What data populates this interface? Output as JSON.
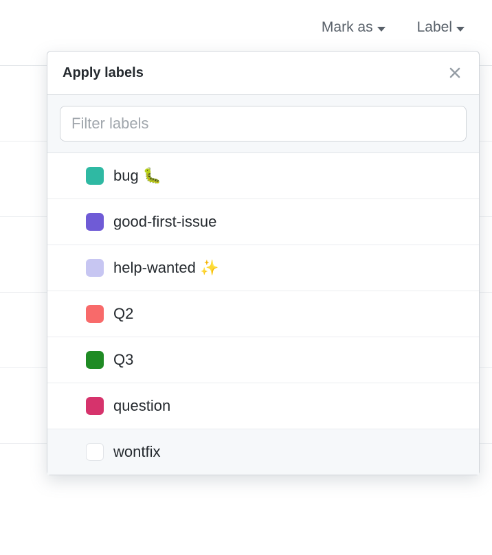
{
  "toolbar": {
    "mark_as_label": "Mark as",
    "label_label": "Label"
  },
  "dropdown": {
    "title": "Apply labels",
    "filter_placeholder": "Filter labels",
    "labels": [
      {
        "name": "bug 🐛",
        "color": "#2fb9a3",
        "swatch_class": "swatch-bug"
      },
      {
        "name": "good-first-issue",
        "color": "#6f5bd6",
        "swatch_class": "swatch-gfi"
      },
      {
        "name": "help-wanted ✨",
        "color": "#c7c6f2",
        "swatch_class": "swatch-help"
      },
      {
        "name": "Q2",
        "color": "#f86a6a",
        "swatch_class": "swatch-q2"
      },
      {
        "name": "Q3",
        "color": "#1f8b24",
        "swatch_class": "swatch-q3"
      },
      {
        "name": "question",
        "color": "#d6336c",
        "swatch_class": "swatch-question"
      },
      {
        "name": "wontfix",
        "color": "#ffffff",
        "swatch_class": "swatch-wontfix"
      }
    ]
  }
}
